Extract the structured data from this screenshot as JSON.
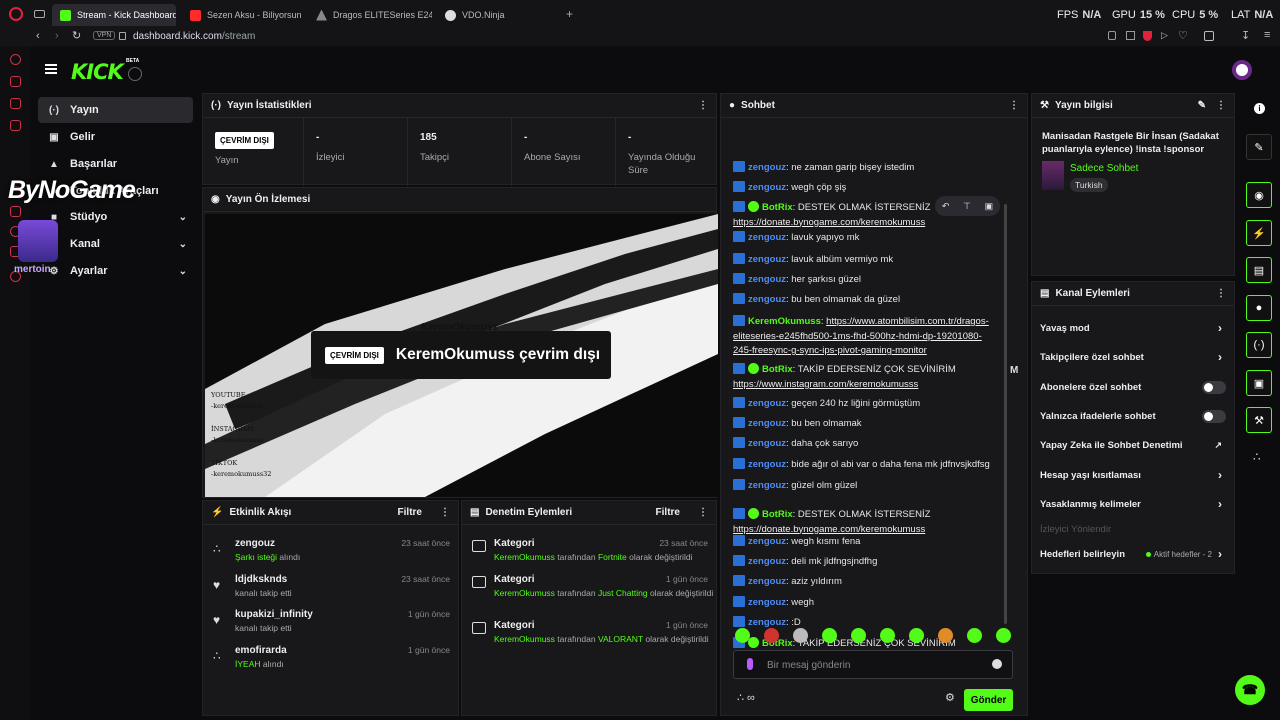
{
  "browser": {
    "tabs": [
      {
        "label": "Stream - Kick Dashboard",
        "color": "#53fc18"
      },
      {
        "label": "Sezen Aksu - Biliyorsun (",
        "color": "#ff2a2a"
      },
      {
        "label": "Dragos ELITESeries E245",
        "color": "#cccccc"
      },
      {
        "label": "VDO.Ninja",
        "color": "#dddddd"
      }
    ],
    "new_tab": "+",
    "vpn": "VPN",
    "url_domain": "dashboard.kick.com",
    "url_path": "/stream",
    "hud": {
      "fps_label": "FPS",
      "fps_value": "N/A",
      "gpu_label": "GPU",
      "gpu_value": "15 %",
      "cpu_label": "CPU",
      "cpu_value": "5 %",
      "lat_label": "LAT",
      "lat_value": "N/A"
    }
  },
  "overlay": {
    "watermark": "ByNoGame",
    "sub_logo": "mertoin"
  },
  "app": {
    "logo": "KICK",
    "beta": "BETA",
    "nav": [
      {
        "label": "Yayın",
        "icon": "broadcast-icon"
      },
      {
        "label": "Gelir",
        "icon": "revenue-icon"
      },
      {
        "label": "Başarılar",
        "icon": "trophy-icon"
      },
      {
        "label": "Topluluk Araçları",
        "icon": "community-icon"
      },
      {
        "label": "Stüdyo",
        "icon": "studio-icon"
      },
      {
        "label": "Kanal",
        "icon": "channel-icon"
      },
      {
        "label": "Ayarlar",
        "icon": "settings-icon"
      }
    ]
  },
  "stats": {
    "title": "Yayın İstatistikleri",
    "items": [
      {
        "value": "ÇEVRİM DIŞI",
        "label": "Yayın"
      },
      {
        "value": "-",
        "label": "İzleyici"
      },
      {
        "value": "185",
        "label": "Takipçi"
      },
      {
        "value": "-",
        "label": "Abone Sayısı"
      },
      {
        "value": "-",
        "label": "Yayında Olduğu Süre"
      }
    ]
  },
  "preview": {
    "title": "Yayın Ön İzlemesi",
    "badge": "ÇEVRİM DIŞI",
    "status_text": "KeremOkumuss çevrim dışı",
    "banner_name": "KeremOkumuss",
    "banner_social": [
      "YOUTUBE",
      "-keremokumuss",
      "İNSTAGRAM",
      "-keremokumuss",
      "TİKTOK",
      "-keremokumuss32"
    ]
  },
  "activity": {
    "title": "Etkinlik Akışı",
    "filter": "Filtre",
    "items": [
      {
        "name": "zengouz",
        "highlight": "Şarkı isteği",
        "rest": " alındı",
        "time": "23 saat önce"
      },
      {
        "name": "ldjdksknds",
        "highlight": "",
        "rest": "kanalı takip etti",
        "time": "23 saat önce"
      },
      {
        "name": "kupakizi_infinity",
        "highlight": "",
        "rest": "kanalı takip etti",
        "time": "1 gün önce"
      },
      {
        "name": "emofirarda",
        "highlight": "İYEAH",
        "rest": " alındı",
        "time": "1 gün önce"
      }
    ]
  },
  "moderation": {
    "title": "Denetim Eylemleri",
    "filter": "Filtre",
    "items": [
      {
        "name": "Kategori",
        "user": "KeremOkumuss",
        "mid": " tarafından ",
        "game": "Fortnite",
        "end": " olarak değiştirildi",
        "time": "23 saat önce"
      },
      {
        "name": "Kategori",
        "user": "KeremOkumuss",
        "mid": " tarafından ",
        "game": "Just Chatting",
        "end": " olarak değiştirildi",
        "time": "1 gün önce"
      },
      {
        "name": "Kategori",
        "user": "KeremOkumuss",
        "mid": " tarafından ",
        "game": "VALORANT",
        "end": " olarak değiştirildi",
        "time": "1 gün önce"
      }
    ]
  },
  "chat": {
    "title": "Sohbet",
    "messages": [
      {
        "user": "zengouz",
        "text": ": ne zaman garip bişey istedim",
        "color": "#4e8df5",
        "verified": false
      },
      {
        "user": "zengouz",
        "text": ": wegh çöp şiş",
        "color": "#4e8df5",
        "verified": false
      },
      {
        "user": "BotRix",
        "text": ": DESTEK OLMAK İSTERSENİZ ",
        "link": "https://donate.bynogame.com/keremokumuss",
        "color": "#53fc18",
        "verified": true
      },
      {
        "user": "zengouz",
        "text": ": lavuk yapıyo mk",
        "color": "#4e8df5",
        "verified": false
      },
      {
        "user": "zengouz",
        "text": ": lavuk albüm vermiyo mk",
        "color": "#4e8df5",
        "verified": false
      },
      {
        "user": "zengouz",
        "text": ": her şarkısı güzel",
        "color": "#4e8df5",
        "verified": false
      },
      {
        "user": "zengouz",
        "text": ": bu ben olmamak da güzel",
        "color": "#4e8df5",
        "verified": false
      },
      {
        "user": "KeremOkumuss",
        "text": ": ",
        "link": "https://www.atombilisim.com.tr/dragos-eliteseries-e245fhd500-1ms-fhd-500hz-hdmi-dp-19201080-245-freesync-g-sync-ips-pivot-gaming-monitor",
        "color": "#53fc18",
        "verified": false
      },
      {
        "user": "BotRix",
        "text": ": TAKİP EDERSENİZ ÇOK SEVİNİRİM ",
        "link": "https://www.instagram.com/keremokumusss",
        "color": "#53fc18",
        "verified": true
      },
      {
        "user": "zengouz",
        "text": ": geçen 240 hz liğini görmüştüm",
        "color": "#4e8df5",
        "verified": false
      },
      {
        "user": "zengouz",
        "text": ": bu ben olmamak",
        "color": "#4e8df5",
        "verified": false
      },
      {
        "user": "zengouz",
        "text": ": daha çok sarıyo",
        "color": "#4e8df5",
        "verified": false
      },
      {
        "user": "zengouz",
        "text": ": bide ağır ol abi var o daha fena mk jdfnvsjkdfsg",
        "color": "#4e8df5",
        "verified": false
      },
      {
        "user": "zengouz",
        "text": ": güzel olm güzel",
        "color": "#4e8df5",
        "verified": false
      },
      {
        "user": "BotRix",
        "text": ": DESTEK OLMAK İSTERSENİZ ",
        "link": "https://donate.bynogame.com/keremokumuss",
        "color": "#53fc18",
        "verified": true
      },
      {
        "user": "zengouz",
        "text": ": wegh kısmı fena",
        "color": "#4e8df5",
        "verified": false
      },
      {
        "user": "zengouz",
        "text": ": deli mk jldfngsjndfhg",
        "color": "#4e8df5",
        "verified": false
      },
      {
        "user": "zengouz",
        "text": ": aziz yıldırım",
        "color": "#4e8df5",
        "verified": false
      },
      {
        "user": "zengouz",
        "text": ": wegh",
        "color": "#4e8df5",
        "verified": false
      },
      {
        "user": "zengouz",
        "text": ": :D",
        "color": "#4e8df5",
        "verified": false
      },
      {
        "user": "BotRix",
        "text": ": TAKİP EDERSENİZ ÇOK SEVİNİRİM ",
        "link": "https://www.instagram.com/keremokumusss",
        "color": "#53fc18",
        "verified": true
      }
    ],
    "input_placeholder": "Bir mesaj gönderin",
    "send": "Gönder",
    "m_label": "M"
  },
  "stream_info": {
    "title": "Yayın bilgisi",
    "stream_title": "Manisadan Rastgele Bir İnsan (Sadakat puanlarıyla eylence) !insta !sponsor",
    "category": "Sadece Sohbet",
    "language": "Turkish"
  },
  "channel_actions": {
    "title": "Kanal Eylemleri",
    "items": [
      {
        "label": "Yavaş mod",
        "kind": "arrow"
      },
      {
        "label": "Takipçilere özel sohbet",
        "kind": "arrow"
      },
      {
        "label": "Abonelere özel sohbet",
        "kind": "toggle"
      },
      {
        "label": "Yalnızca ifadelerle sohbet",
        "kind": "toggle"
      },
      {
        "label": "Yapay Zeka ile Sohbet Denetimi",
        "kind": "external"
      },
      {
        "label": "Hesap yaşı kısıtlaması",
        "kind": "arrow"
      },
      {
        "label": "Yasaklanmış kelimeler",
        "kind": "arrow"
      },
      {
        "label": "İzleyici Yönlendir",
        "kind": "disabled"
      },
      {
        "label": "Hedefleri belirleyin",
        "kind": "goal"
      }
    ],
    "goal_status": "Aktif hedefler - 2"
  },
  "colors": {
    "accent": "#53fc18",
    "panel": "#18181b",
    "background": "#0c0c0e"
  }
}
